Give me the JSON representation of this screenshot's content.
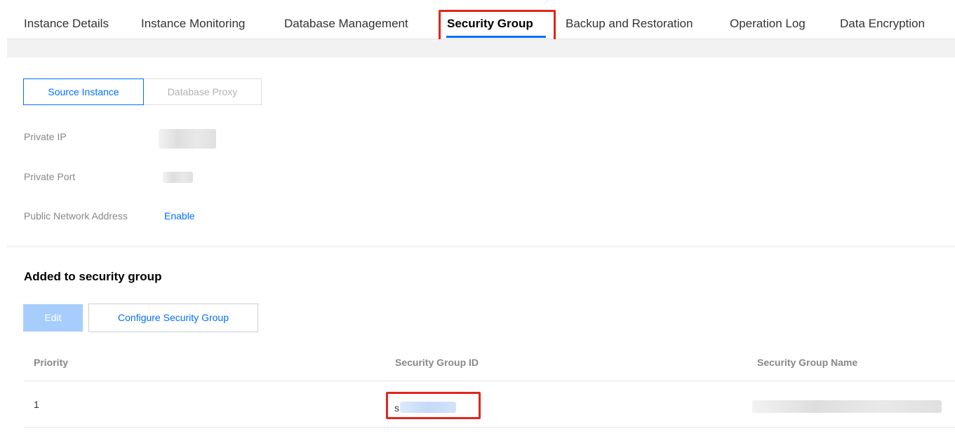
{
  "tabs": [
    {
      "label": "Instance Details",
      "active": false
    },
    {
      "label": "Instance Monitoring",
      "active": false
    },
    {
      "label": "Database Management",
      "active": false
    },
    {
      "label": "Security Group",
      "active": true
    },
    {
      "label": "Backup and Restoration",
      "active": false
    },
    {
      "label": "Operation Log",
      "active": false
    },
    {
      "label": "Data Encryption",
      "active": false
    }
  ],
  "instance_switch": {
    "source_instance": "Source Instance",
    "database_proxy": "Database Proxy",
    "selected": "Source Instance"
  },
  "fields": {
    "private_ip_label": "Private IP",
    "private_port_label": "Private Port",
    "public_address_label": "Public Network Address",
    "public_address_action": "Enable"
  },
  "security_group": {
    "title": "Added to security group",
    "edit_label": "Edit",
    "configure_label": "Configure Security Group",
    "columns": [
      "Priority",
      "Security Group ID",
      "Security Group Name"
    ],
    "rows": [
      {
        "priority": "1",
        "id_prefix": "s"
      }
    ]
  },
  "colors": {
    "accent": "#006eff",
    "highlight": "#e1251b",
    "disabled_button": "#a6cdfc"
  }
}
